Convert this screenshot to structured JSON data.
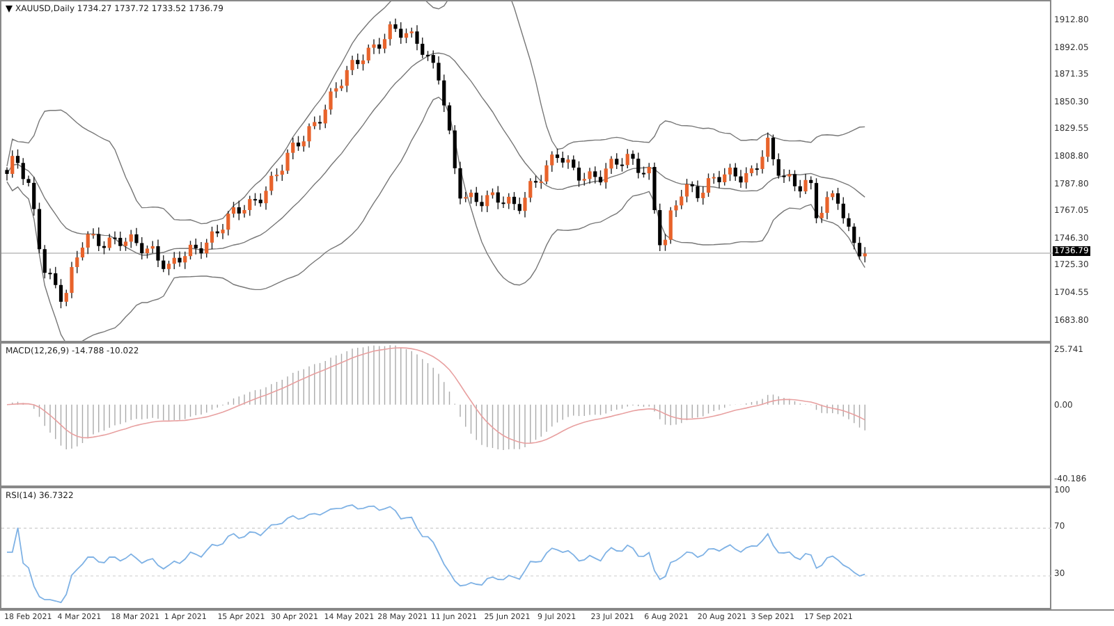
{
  "main_chart": {
    "title": "XAUUSD,Daily  1734.27 1737.72 1733.52 1736.79",
    "price_labels": [
      "1912.80",
      "1892.05",
      "1871.35",
      "1850.30",
      "1829.55",
      "1808.80",
      "1787.80",
      "1767.05",
      "1746.30",
      "1725.30",
      "1704.55",
      "1683.80"
    ],
    "current_price": "1736.79"
  },
  "macd_panel": {
    "title": "MACD(12,26,9) -14.788 -10.022",
    "axis_labels": [
      "25.741",
      "0.00",
      "-40.186"
    ]
  },
  "rsi_panel": {
    "title": "RSI(14) 36.7322",
    "axis_labels": [
      "100",
      "70",
      "30"
    ]
  },
  "date_axis": [
    "18 Feb 2021",
    "4 Mar 2021",
    "18 Mar 2021",
    "1 Apr 2021",
    "15 Apr 2021",
    "30 Apr 2021",
    "14 May 2021",
    "28 May 2021",
    "11 Jun 2021",
    "25 Jun 2021",
    "9 Jul 2021",
    "23 Jul 2021",
    "6 Aug 2021",
    "20 Aug 2021",
    "3 Sep 2021",
    "17 Sep 2021"
  ]
}
